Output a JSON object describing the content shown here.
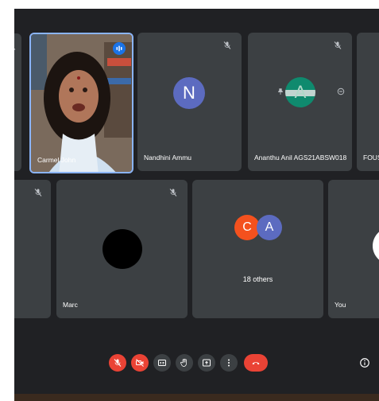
{
  "participants": {
    "carmel": {
      "name": "Carmel John"
    },
    "nandhini": {
      "name": "Nandhini Ammu",
      "initial": "N",
      "color": "#5c6bc0"
    },
    "ananthu": {
      "name": "Ananthu Anil AGS21ABSW018",
      "initial": "A",
      "color": "#0f8a6e"
    },
    "fous": {
      "name": "FOUS"
    },
    "marc": {
      "name": "Marc"
    },
    "others": {
      "label": "18 others",
      "initial_1": "C",
      "color_1": "#f4511e",
      "initial_2": "A",
      "color_2": "#5c6bc0"
    },
    "you": {
      "name": "You"
    }
  },
  "colors": {
    "accent_speaking": "#8ab4f8",
    "end_call": "#ea4335",
    "muted": "#ea4335"
  },
  "controls": {
    "icons": [
      "mic-off-icon",
      "camera-off-icon",
      "captions-icon",
      "raise-hand-icon",
      "present-icon",
      "more-options-icon",
      "end-call-icon",
      "info-icon"
    ]
  }
}
